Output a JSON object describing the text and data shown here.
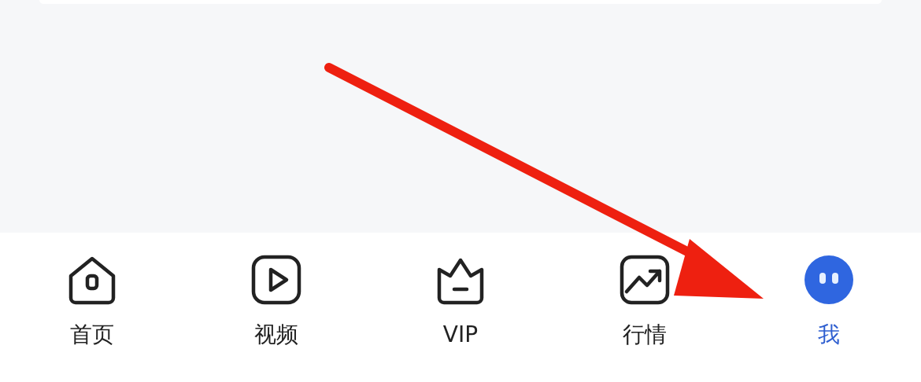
{
  "tab_bar": {
    "tabs": [
      {
        "label": "首页",
        "selected": false
      },
      {
        "label": "视频",
        "selected": false
      },
      {
        "label": "VIP",
        "selected": false
      },
      {
        "label": "行情",
        "selected": false
      },
      {
        "label": "我",
        "selected": true
      }
    ]
  }
}
